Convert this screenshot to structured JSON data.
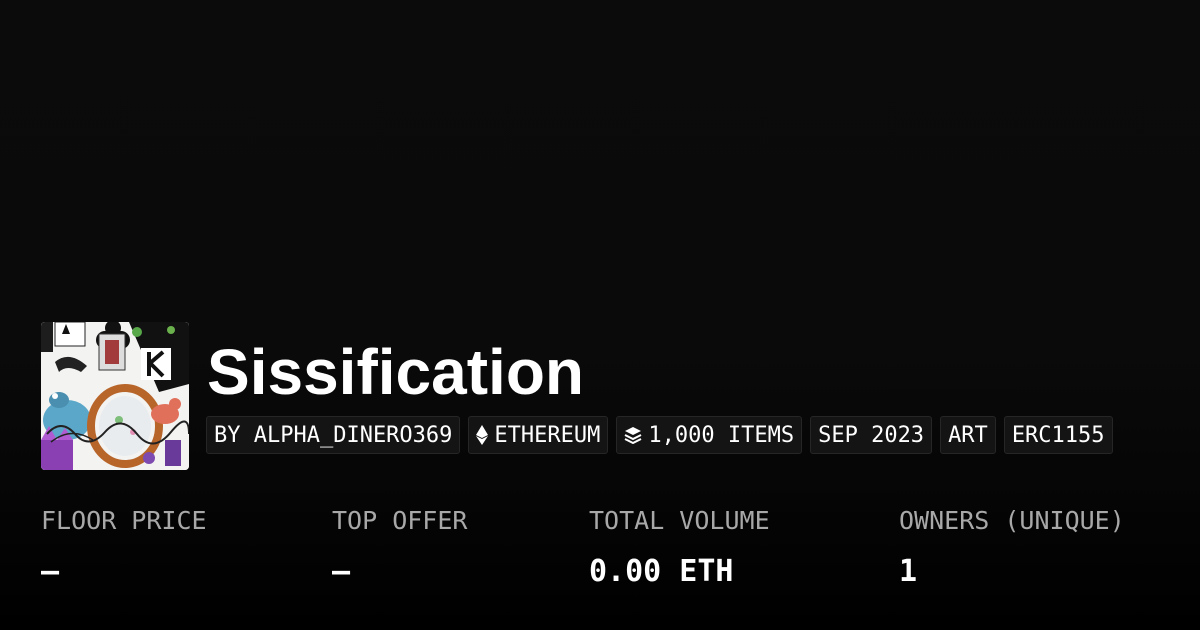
{
  "collection": {
    "name": "Sissification",
    "avatar_icon": "collection-artwork-image"
  },
  "tags": [
    {
      "label": "BY ALPHA_DINERO369",
      "icon": null
    },
    {
      "label": "ETHEREUM",
      "icon": "ethereum-icon"
    },
    {
      "label": "1,000 ITEMS",
      "icon": "layers-icon"
    },
    {
      "label": "SEP 2023",
      "icon": null
    },
    {
      "label": "ART",
      "icon": null
    },
    {
      "label": "ERC1155",
      "icon": null
    }
  ],
  "stats": [
    {
      "label": "FLOOR PRICE",
      "value": "—"
    },
    {
      "label": "TOP OFFER",
      "value": "—"
    },
    {
      "label": "TOTAL VOLUME",
      "value": "0.00 ETH"
    },
    {
      "label": "OWNERS (UNIQUE)",
      "value": "1"
    }
  ],
  "colors": {
    "background": "#0a0a0a",
    "text": "#ffffff",
    "muted_text": "#a8a8a8",
    "tag_background": "#141414",
    "tag_border": "#262626"
  }
}
